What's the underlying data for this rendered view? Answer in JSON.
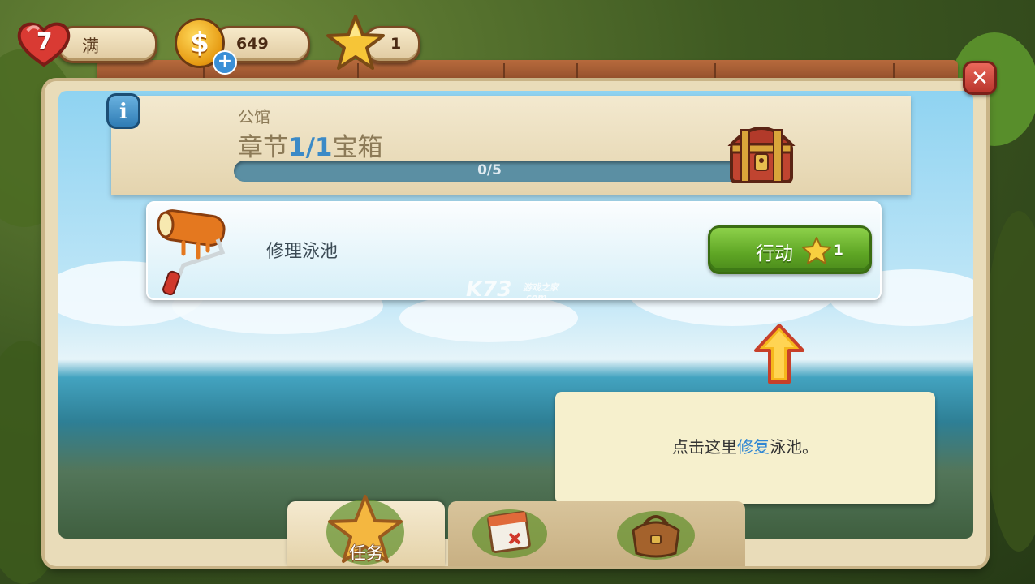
{
  "hud": {
    "lives_value": "7",
    "lives_status": "满",
    "coins": "649",
    "stars": "1"
  },
  "chapter": {
    "subtitle": "公馆",
    "title_prefix": "章节",
    "current": "1",
    "separator": "/",
    "total": "1",
    "title_suffix": "宝箱",
    "progress_text": "0/5",
    "progress_fraction": 0
  },
  "task": {
    "label": "修理泳池",
    "action_label": "行动",
    "action_cost": "1"
  },
  "watermark": {
    "logo": "K73",
    "tagline": "游戏之家",
    "domain": ".com"
  },
  "tooltip": {
    "before": "点击这里",
    "highlight": "修复",
    "after": "泳池。"
  },
  "tabs": [
    {
      "label": "任务",
      "icon": "star-icon",
      "active": true
    },
    {
      "label": "",
      "icon": "calendar-icon",
      "active": false
    },
    {
      "label": "",
      "icon": "bag-icon",
      "active": false
    }
  ],
  "colors": {
    "action_green": "#5ea524",
    "highlight_blue": "#2f86d3",
    "tooltip_bg": "#f6f0cd",
    "close_red": "#c9443a"
  }
}
